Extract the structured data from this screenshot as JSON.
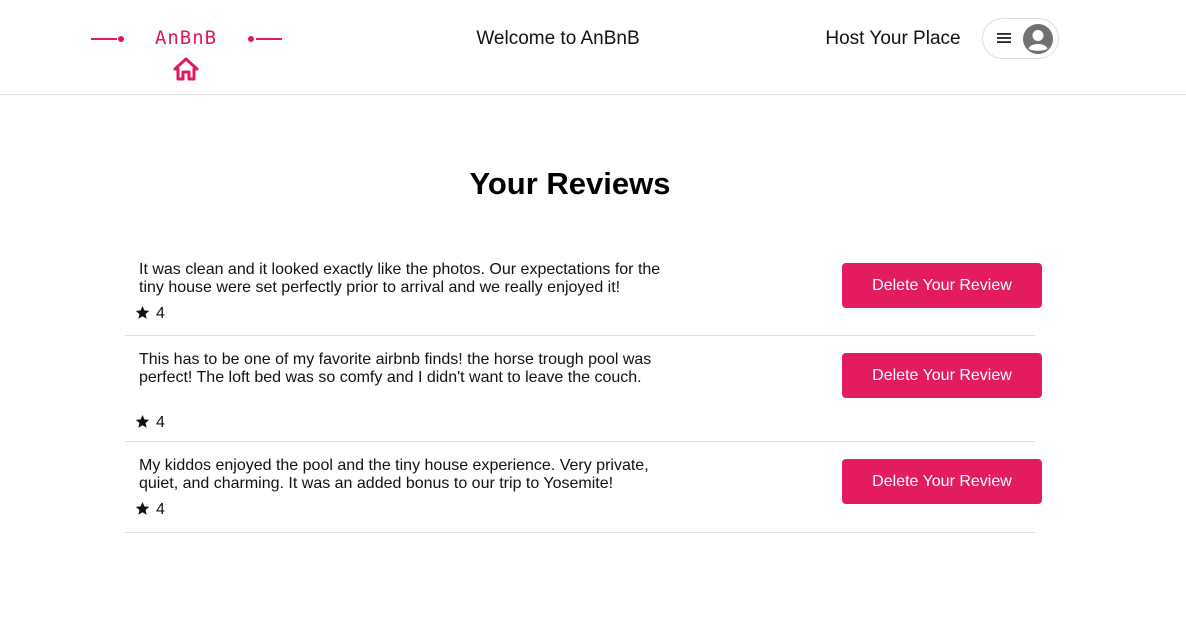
{
  "header": {
    "brand": "AnBnB",
    "brand_color": "#e0185c",
    "logo_icon": "house-icon",
    "welcome_text": "Welcome to AnBnB",
    "host_link": "Host Your Place",
    "menu_icon": "hamburger-menu-icon",
    "avatar_icon": "user-avatar-icon"
  },
  "main": {
    "title": "Your Reviews",
    "reviews": [
      {
        "text": "It was clean and it looked exactly like the photos. Our expectations for the tiny house were set perfectly prior to arrival and we really enjoyed it!",
        "stars": "4",
        "delete_label": "Delete Your Review"
      },
      {
        "text": "This has to be one of my favorite airbnb finds! the horse trough pool was perfect! The loft bed was so comfy and I didn't want to leave the couch.",
        "stars": "4",
        "delete_label": "Delete Your Review"
      },
      {
        "text": "My kiddos enjoyed the pool and the tiny house experience. Very private, quiet, and charming. It was an added bonus to our trip to Yosemite!",
        "stars": "4",
        "delete_label": "Delete Your Review"
      }
    ],
    "button_color": "#e31c5f",
    "star_icon": "star-icon"
  }
}
